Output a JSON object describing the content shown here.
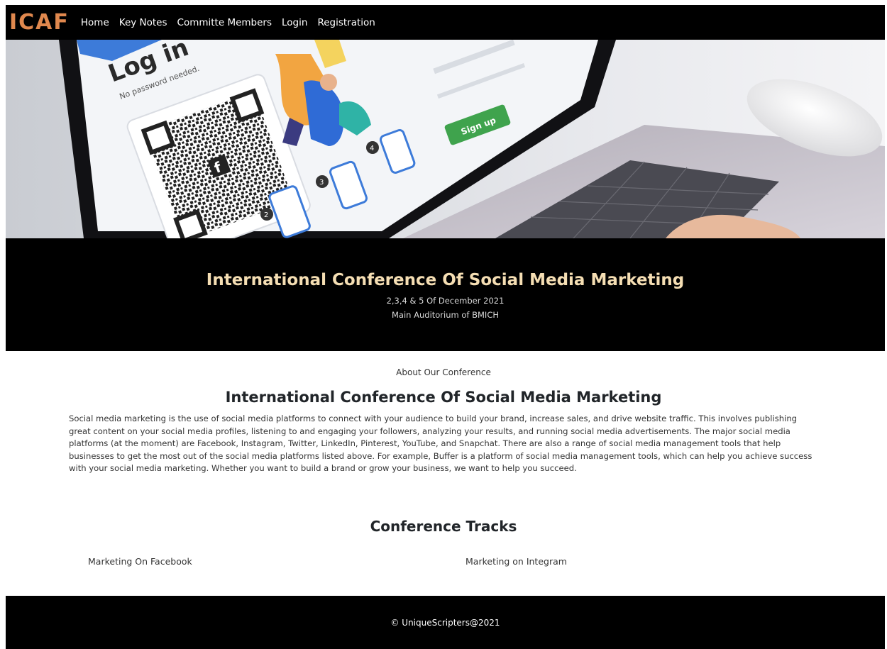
{
  "brand": {
    "logo_text": "ICAF",
    "logo_color": "#e0884e"
  },
  "nav": {
    "items": [
      {
        "label": "Home"
      },
      {
        "label": "Key Notes"
      },
      {
        "label": "Committe Members"
      },
      {
        "label": "Login"
      },
      {
        "label": "Registration"
      }
    ]
  },
  "hero_image": {
    "screen_text": {
      "login": "Log in",
      "no_password": "No password needed.",
      "sign_up": "Sign up"
    }
  },
  "banner": {
    "title": "International Conference Of Social Media Marketing",
    "date": "2,3,4 & 5 Of December 2021",
    "venue": "Main Auditorium of BMICH",
    "title_color": "#f5deb3"
  },
  "about": {
    "label": "About Our Conference",
    "title": "International Conference Of Social Media Marketing",
    "body": "Social media marketing is the use of social media platforms to connect with your audience to build your brand, increase sales, and drive website traffic. This involves publishing great content on your social media profiles, listening to and engaging your followers, analyzing your results, and running social media advertisements. The major social media platforms (at the moment) are Facebook, Instagram, Twitter, LinkedIn, Pinterest, YouTube, and Snapchat. There are also a range of social media management tools that help businesses to get the most out of the social media platforms listed above. For example, Buffer is a platform of social media management tools, which can help you achieve success with your social media marketing. Whether you want to build a brand or grow your business, we want to help you succeed."
  },
  "tracks": {
    "title": "Conference Tracks",
    "items": [
      {
        "label": "Marketing On Facebook"
      },
      {
        "label": "Marketing on Integram"
      }
    ]
  },
  "footer": {
    "text": "© UniqueScripters@2021"
  }
}
